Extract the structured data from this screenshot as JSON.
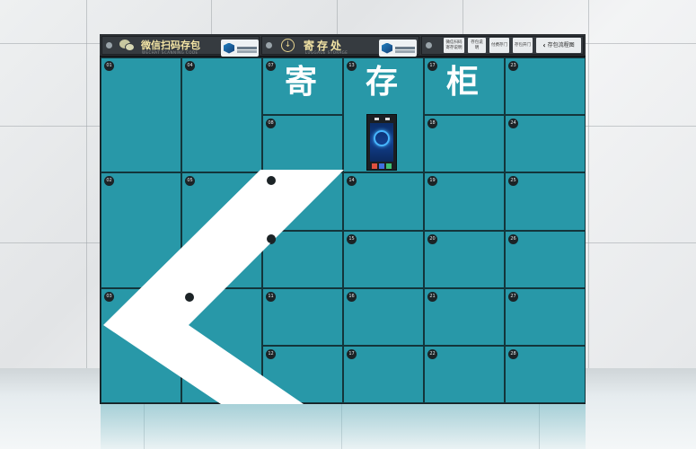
{
  "header": {
    "wechat_title": "微信扫码存包",
    "wechat_subtitle": "WECHAT SCANNING CODE",
    "store_title": "寄存处",
    "store_subtitle": "LUGGAGE STORAGE",
    "signs": [
      "微信扫码寄存说明",
      "存包说明",
      "付费存门",
      "存包开门"
    ],
    "last_sign": "存包流程图",
    "last_sign_sub": "STORE FLOW DIAGRAM"
  },
  "big_title": [
    "寄",
    "存",
    "柜"
  ],
  "lockers": [
    "01",
    "02",
    "03",
    "04",
    "05",
    "06",
    "07",
    "08",
    "09",
    "10",
    "11",
    "12",
    "13",
    "14",
    "15",
    "16",
    "17",
    "18",
    "19",
    "20",
    "21",
    "22",
    "23",
    "24",
    "25",
    "26",
    "27",
    "28"
  ],
  "colors": {
    "door": "#2898a8",
    "frame": "#1a1d20",
    "title": "#ffffff",
    "header_text": "#f2e3a4",
    "arrow": "#ffffff"
  },
  "icons": [
    "wechat-icon",
    "down-arrow-icon",
    "lock-icon",
    "chevron-left-icon",
    "brand-logo-icon"
  ]
}
